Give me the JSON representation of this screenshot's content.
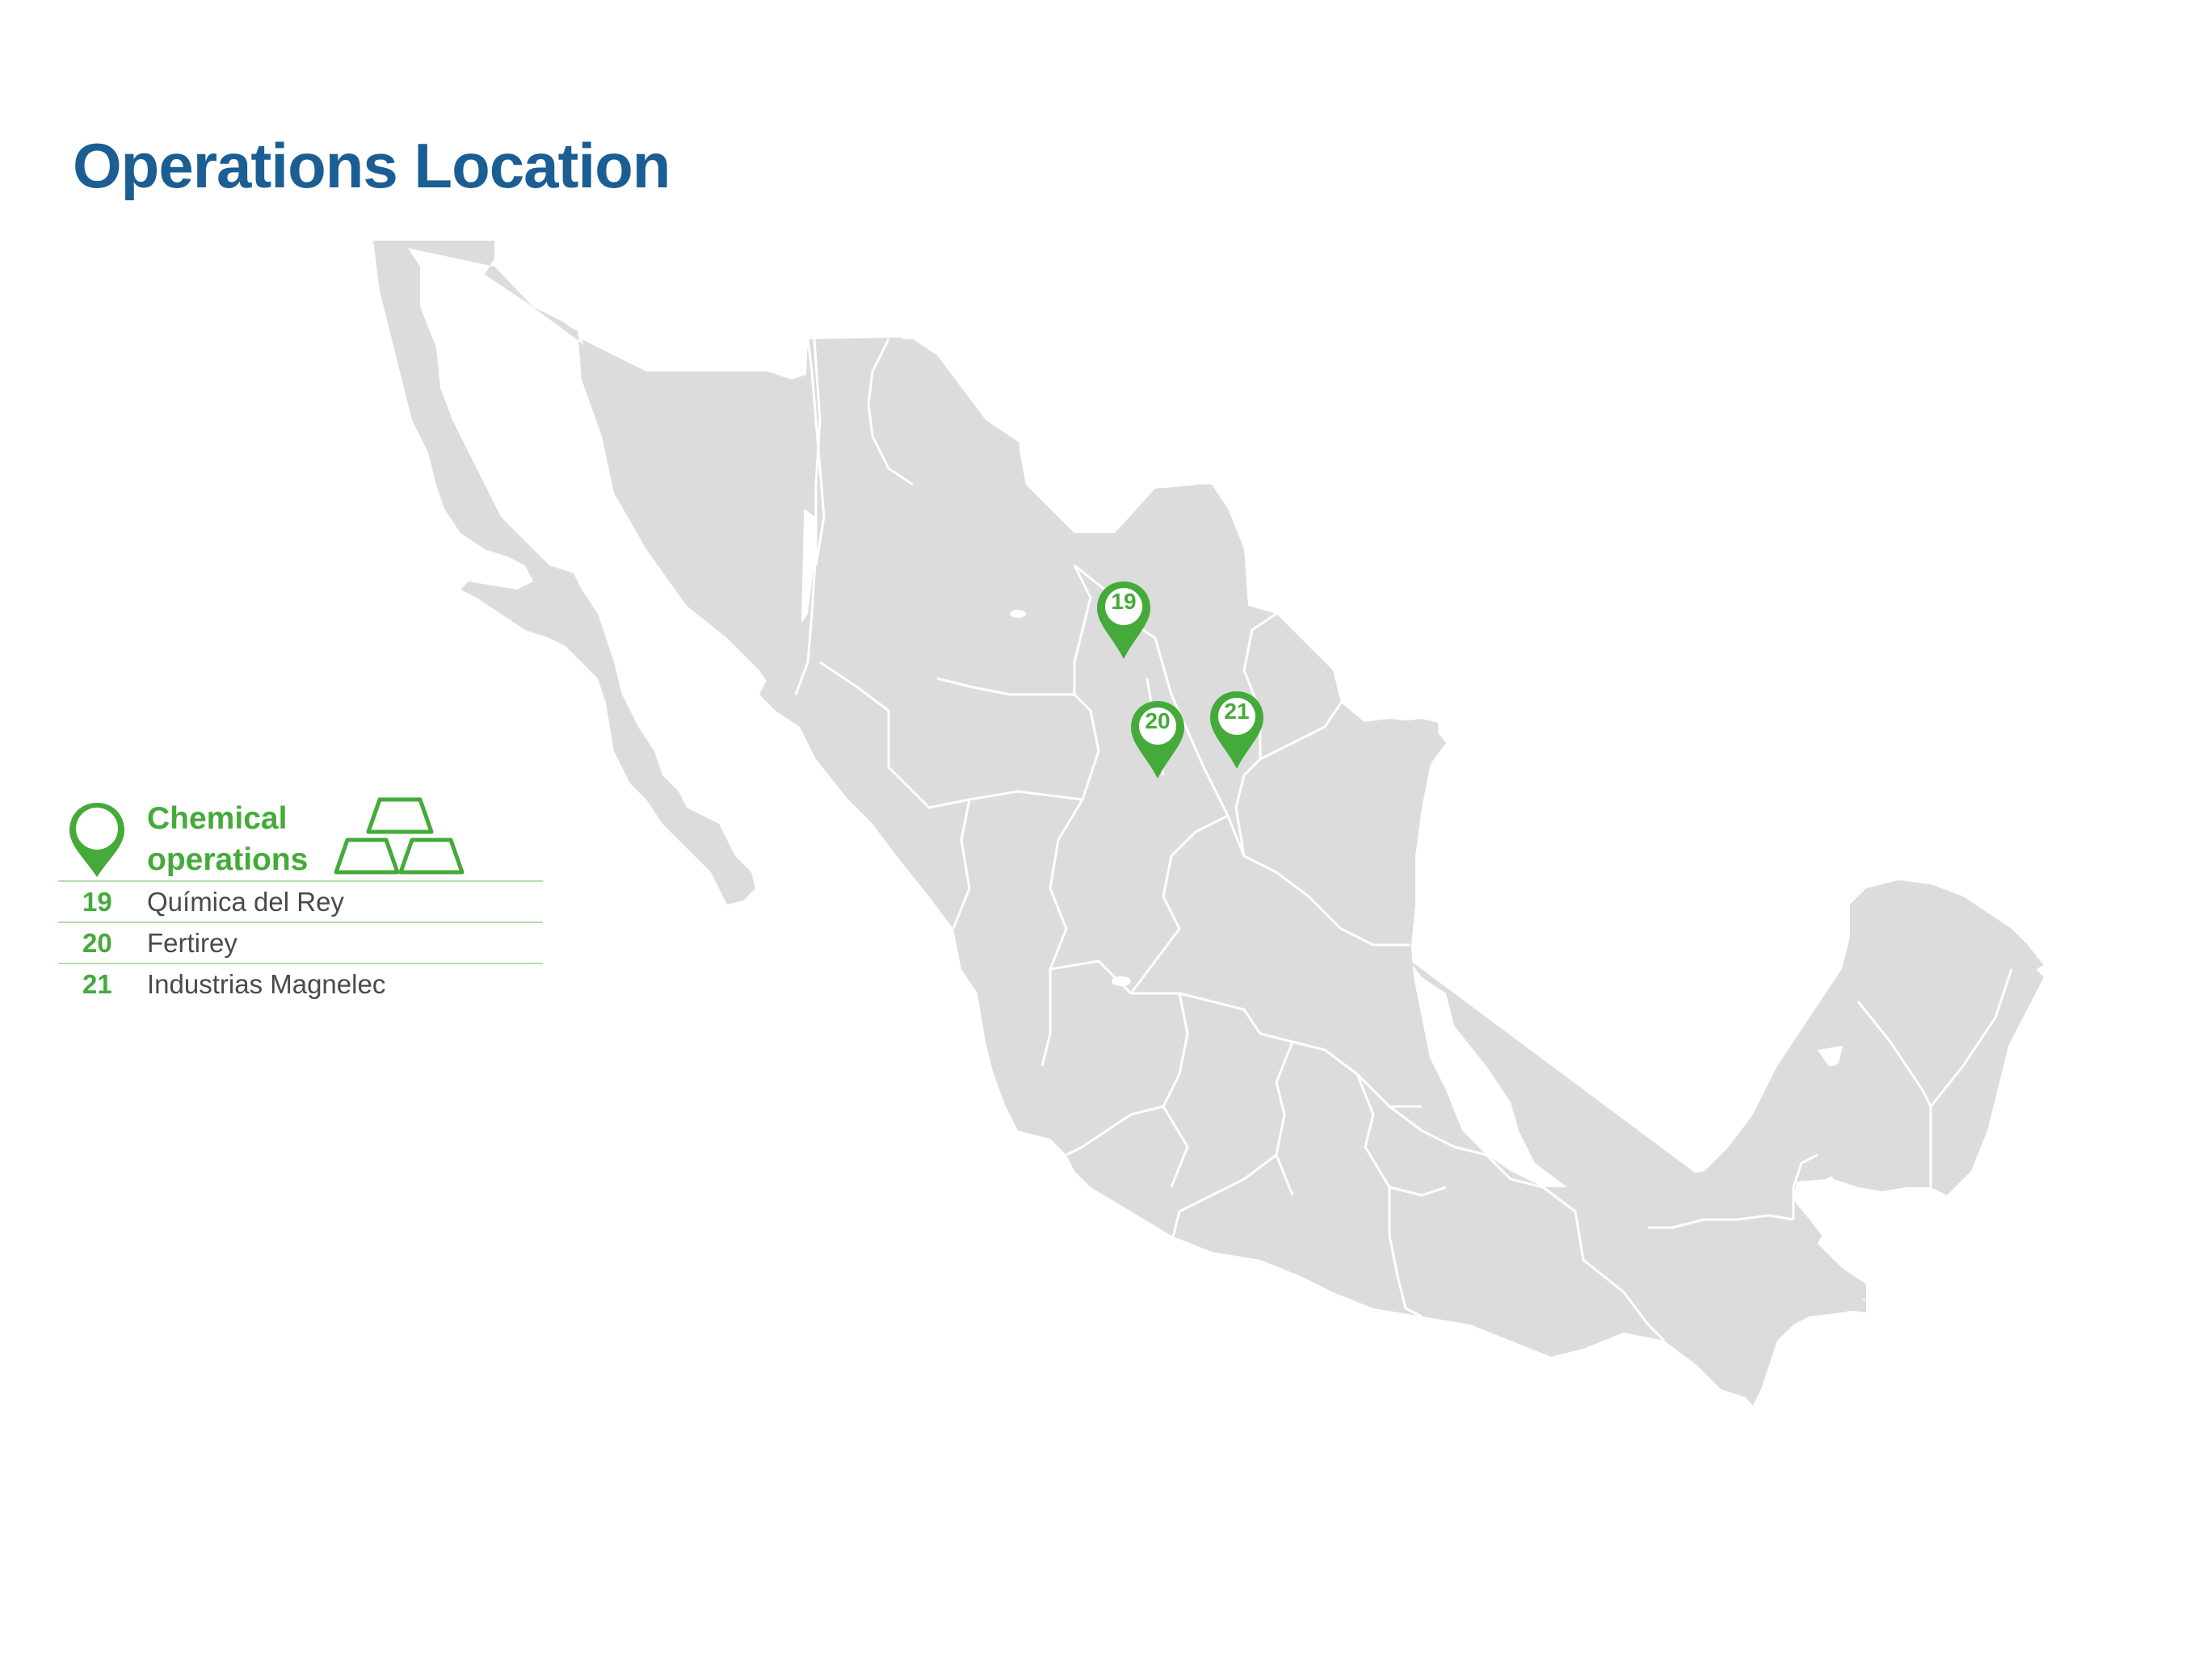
{
  "header": {
    "title": "Operations Location"
  },
  "legend": {
    "title": "Chemical operations",
    "pin_icon": "map-pin-icon",
    "category_icon": "gold-bars-icon",
    "items": [
      {
        "number": "19",
        "name": "Química del Rey"
      },
      {
        "number": "20",
        "name": "Fertirey"
      },
      {
        "number": "21",
        "name": "Industrias Magnelec"
      }
    ]
  },
  "map": {
    "land_color": "#dcdcdc",
    "border_color": "#ffffff",
    "pins": [
      {
        "number": "19"
      },
      {
        "number": "20"
      },
      {
        "number": "21"
      }
    ]
  },
  "colors": {
    "title": "#1a5e93",
    "accent": "#44ab3a",
    "text": "#4a4a4a",
    "rule": "#b6dcae"
  }
}
